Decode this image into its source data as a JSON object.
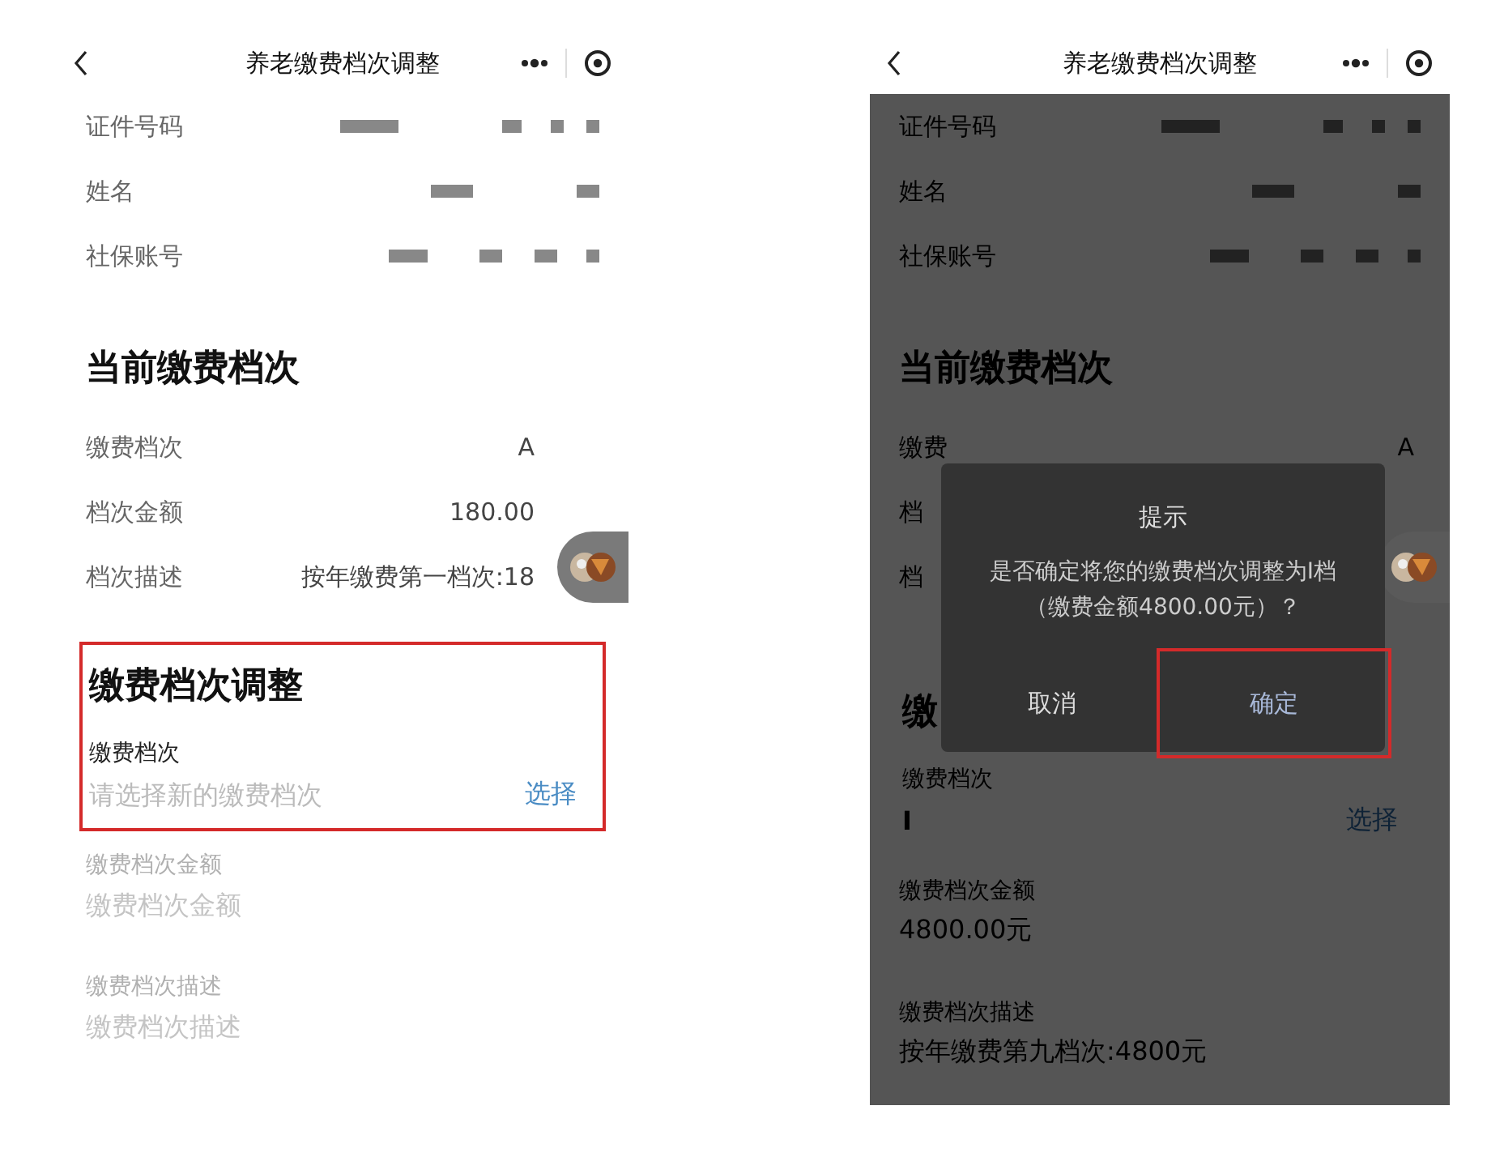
{
  "screens": [
    {
      "title": "养老缴费档次调整",
      "dimmed": false,
      "info_rows": [
        {
          "label": "证件号码"
        },
        {
          "label": "姓名"
        },
        {
          "label": "社保账号"
        }
      ],
      "current": {
        "heading": "当前缴费档次",
        "rows": [
          {
            "label": "缴费档次",
            "value": "A"
          },
          {
            "label": "档次金额",
            "value": "180.00"
          },
          {
            "label": "档次描述",
            "value": "按年缴费第一档次:18"
          }
        ]
      },
      "adjust": {
        "heading": "缴费档次调整",
        "highlighted": true,
        "field_label": "缴费档次",
        "placeholder": "请选择新的缴费档次",
        "action": "选择"
      },
      "amount": {
        "label": "缴费档次金额",
        "placeholder": "缴费档次金额"
      },
      "description": {
        "label": "缴费档次描述",
        "placeholder": "缴费档次描述"
      }
    },
    {
      "title": "养老缴费档次调整",
      "dimmed": true,
      "info_rows": [
        {
          "label": "证件号码"
        },
        {
          "label": "姓名"
        },
        {
          "label": "社保账号"
        }
      ],
      "current": {
        "heading": "当前缴费档次",
        "rows": [
          {
            "label": "缴费",
            "value": "A"
          },
          {
            "label": "档"
          },
          {
            "label": "档"
          }
        ]
      },
      "adjust": {
        "heading": "缴",
        "highlighted": false,
        "field_label": "缴费档次",
        "value": "I",
        "action": "选择"
      },
      "amount": {
        "label": "缴费档次金额",
        "value": "4800.00元"
      },
      "description": {
        "label": "缴费档次描述",
        "value": "按年缴费第九档次:4800元"
      },
      "dialog": {
        "title": "提示",
        "message": "是否确定将您的缴费档次调整为I档（缴费金额4800.00元）？",
        "buttons": [
          {
            "label": "取消",
            "highlighted": false
          },
          {
            "label": "确定",
            "highlighted": true
          }
        ]
      }
    }
  ]
}
